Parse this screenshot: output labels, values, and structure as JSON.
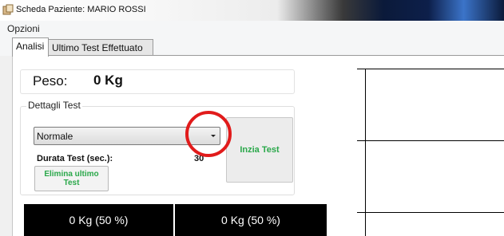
{
  "window": {
    "title": "Scheda Paziente: MARIO ROSSI",
    "app_icon": "patient-app-icon"
  },
  "menu": {
    "items": [
      {
        "label": "Opzioni"
      }
    ]
  },
  "tabs": [
    {
      "label": "Analisi",
      "active": true
    },
    {
      "label": "Ultimo Test Effettuato",
      "active": false
    }
  ],
  "weight": {
    "label": "Peso:",
    "value": "0 Kg"
  },
  "test_details": {
    "group_label": "Dettagli Test",
    "mode_select": {
      "selected": "Normale",
      "icon": "dropdown-arrow-icon"
    },
    "duration_label": "Durata Test (sec.):",
    "duration_value": "30",
    "delete_button": "Elimina ultimo Test",
    "start_button": "Inzia Test"
  },
  "readouts": [
    {
      "text": "0 Kg (50 %)"
    },
    {
      "text": "0 Kg (50 %)"
    }
  ],
  "colors": {
    "accent_green": "#2aa84a",
    "annotation_red": "#e11b1b",
    "readout_bg": "#000000"
  }
}
